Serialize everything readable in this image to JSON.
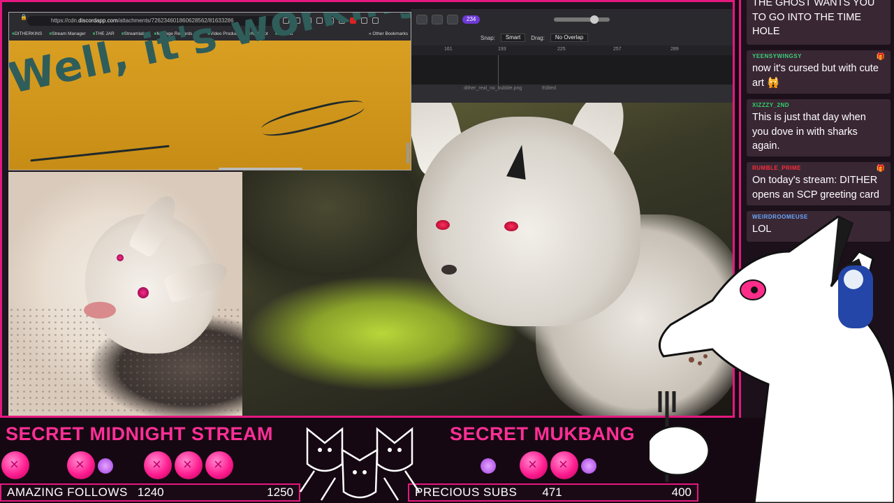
{
  "browser": {
    "url_prefix": "https://cdn.",
    "url_host": "discordapp.com",
    "url_path": "/attachments/726234601860628562/81633286",
    "bookmarks": [
      "DITHERKINS",
      "Stream Manager",
      "THE JAR",
      "Streamlabs",
      "Manage Rewards &...",
      "Video Producer",
      "Nightbot",
      "Moobot"
    ],
    "other_bookmarks": "Other Bookmarks",
    "banner_text": "Well, it's working!"
  },
  "app": {
    "badge": "234",
    "snap_label": "Snap:",
    "snap_value": "Smart",
    "drag_label": "Drag:",
    "drag_value": "No Overlap",
    "ruler": [
      "161",
      "193",
      "225",
      "257",
      "289"
    ],
    "doc_title": "dither_real_no_bubble.png",
    "doc_status": "Edited"
  },
  "chat": {
    "messages": [
      {
        "user": "",
        "text": "THE GHOST WANTS YOU TO GO INTO THE TIME HOLE",
        "color": "#7fd3a0",
        "badge": ""
      },
      {
        "user": "YEENSYWINGSY",
        "text": "now it's cursed but with cute art 🙀",
        "color": "#3ad07a",
        "badge": "🎁"
      },
      {
        "user": "XIZZZY_2ND",
        "text": "This is just that day when you dove in with sharks again.",
        "color": "#2fd36b",
        "badge": ""
      },
      {
        "user": "RUMBLE_PRIME",
        "text": "On today's stream: DITHER opens an SCP greeting card",
        "color": "#ff2d3a",
        "badge": "🎁"
      },
      {
        "user": "WEIRDROOMEUSE",
        "text": "LOL",
        "color": "#6aa8ff",
        "badge": ""
      }
    ]
  },
  "bottom": {
    "left_title": "SECRET MIDNIGHT STREAM",
    "right_title": "SECRET MUKBANG",
    "follows_label": "AMAZING FOLLOWS",
    "follows_current": "1240",
    "follows_goal": "1250",
    "subs_label": "PRECIOUS SUBS",
    "subs_current": "471",
    "subs_goal": "400"
  },
  "colors": {
    "accent": "#e5187f",
    "title_pink": "#ff2f96",
    "chat_bg": "#1c111b"
  }
}
